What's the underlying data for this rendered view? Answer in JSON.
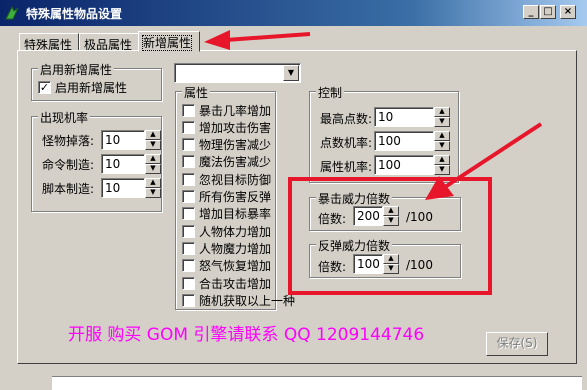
{
  "window": {
    "title": "特殊属性物品设置",
    "min_label": "_",
    "max_label": "□",
    "close_label": "×"
  },
  "tabs": [
    {
      "label": "特殊属性"
    },
    {
      "label": "极品属性"
    },
    {
      "label": "新增属性"
    }
  ],
  "enable_group": {
    "title": "启用新增属性",
    "checkbox_label": "启用新增属性",
    "checked": true,
    "check_mark": "✓"
  },
  "probability_group": {
    "title": "出现机率",
    "rows": [
      {
        "label": "怪物掉落:",
        "value": "10"
      },
      {
        "label": "命令制造:",
        "value": "10"
      },
      {
        "label": "脚本制造:",
        "value": "10"
      }
    ]
  },
  "top_combo": {
    "value": "",
    "arrow": "▼"
  },
  "attr_group": {
    "title": "属性",
    "items": [
      "暴击几率增加",
      "增加攻击伤害",
      "物理伤害减少",
      "魔法伤害减少",
      "忽视目标防御",
      "所有伤害反弹",
      "增加目标暴率",
      "人物体力增加",
      "人物魔力增加",
      "怒气恢复增加",
      "合击攻击增加",
      "随机获取以上一种"
    ]
  },
  "control_group": {
    "title": "控制",
    "rows": [
      {
        "label": "最高点数:",
        "value": "10"
      },
      {
        "label": "点数机率:",
        "value": "100"
      },
      {
        "label": "属性机率:",
        "value": "100"
      }
    ]
  },
  "crit_group": {
    "title": "暴击威力倍数",
    "label": "倍数:",
    "value": "200",
    "suffix": "/100"
  },
  "rebound_group": {
    "title": "反弹威力倍数",
    "label": "倍数:",
    "value": "100",
    "suffix": "/100"
  },
  "promo_text": "开服 购买 GOM 引擎请联系 QQ 1209144746",
  "save_button": "保存(S)",
  "spin_up": "▲",
  "spin_down": "▼",
  "colors": {
    "annotation_red": "#e8162a",
    "promo_magenta": "#ff00ff",
    "titlebar": "#0a246a"
  }
}
